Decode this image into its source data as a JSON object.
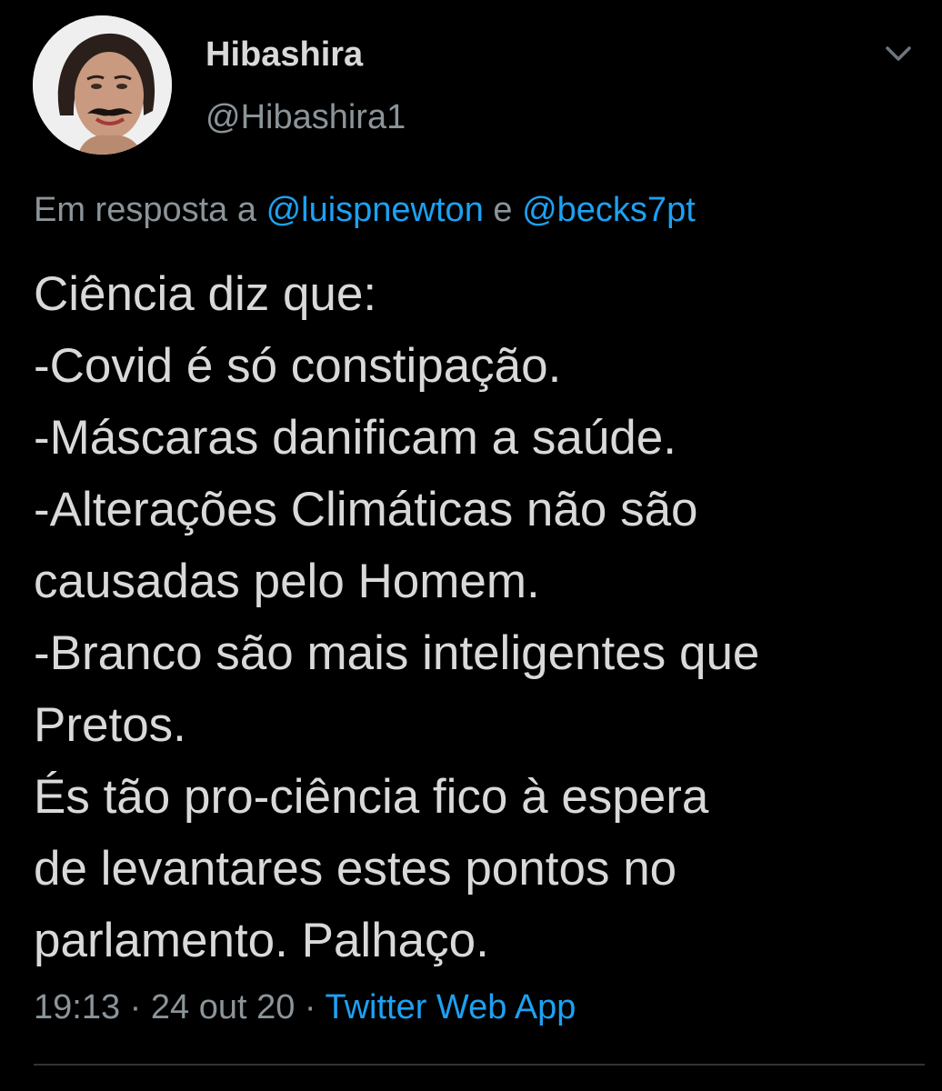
{
  "tweet": {
    "display_name": "Hibashira",
    "handle": "@Hibashira1",
    "reply_prefix": "Em resposta a",
    "reply_mentions": [
      "@luispnewton",
      "@becks7pt"
    ],
    "reply_connector": "e",
    "body_lines": [
      "Ciência diz que:",
      "-Covid é só constipação.",
      "-Máscaras danificam a saúde.",
      "-Alterações Climáticas não são",
      "causadas pelo Homem.",
      "-Branco são mais inteligentes que",
      "Pretos.",
      "És tão pro-ciência fico à espera",
      "de levantares estes pontos no",
      "parlamento. Palhaço."
    ],
    "time": "19:13",
    "date": "24 out 20",
    "separator": "·",
    "source": "Twitter Web App"
  },
  "icons": {
    "menu": "chevron-down-icon",
    "avatar": "profile-photo"
  },
  "colors": {
    "background": "#000000",
    "primary_text": "#d9d9d9",
    "secondary_text": "#8b9499",
    "link": "#1da1f2",
    "divider": "#2f3336"
  }
}
